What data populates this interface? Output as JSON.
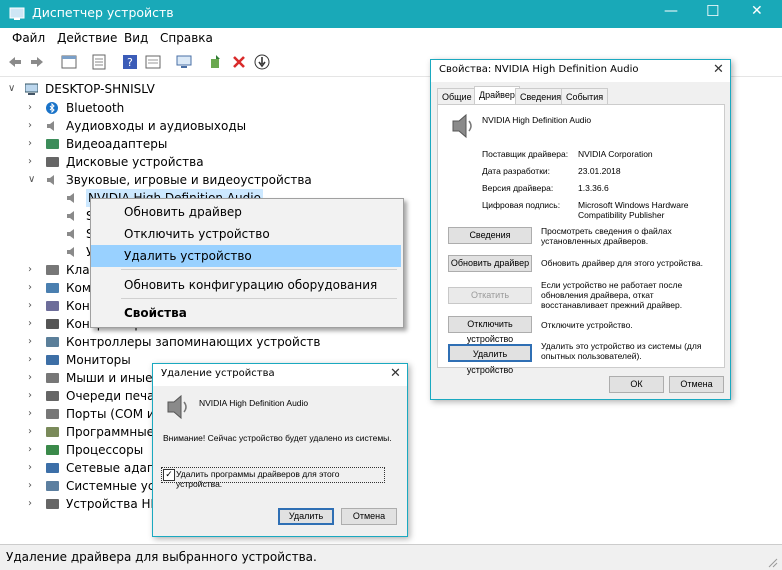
{
  "window": {
    "title": "Диспетчер устройств",
    "minimize": "—",
    "maximize": "☐",
    "close": "✕"
  },
  "menu": [
    "Файл",
    "Действие",
    "Вид",
    "Справка"
  ],
  "tree": {
    "root": "DESKTOP-SHNISLV",
    "items": [
      {
        "label": "Bluetooth",
        "icon": "bluetooth-icon"
      },
      {
        "label": "Аудиовходы и аудиовыходы",
        "icon": "speaker-icon"
      },
      {
        "label": "Видеоадаптеры",
        "icon": "display-adapter-icon"
      },
      {
        "label": "Дисковые устройства",
        "icon": "disk-drive-icon"
      },
      {
        "label": "Звуковые, игровые и видеоустройства",
        "icon": "speaker-icon"
      },
      {
        "label": "NVIDIA High Definition Audio",
        "icon": "speaker-icon"
      },
      {
        "label": "S",
        "icon": "speaker-icon"
      },
      {
        "label": "S",
        "icon": "speaker-icon"
      },
      {
        "label": "У",
        "icon": "speaker-icon"
      },
      {
        "label": "Клав",
        "icon": "keyboard-icon"
      },
      {
        "label": "Комп",
        "icon": "computer-icon"
      },
      {
        "label": "Конт",
        "icon": "controller-icon"
      },
      {
        "label": "Контроллеры USB",
        "icon": "usb-icon"
      },
      {
        "label": "Контроллеры запоминающих устройств",
        "icon": "storage-icon"
      },
      {
        "label": "Мониторы",
        "icon": "monitor-icon"
      },
      {
        "label": "Мыши и иные у",
        "icon": "mouse-icon"
      },
      {
        "label": "Очереди печати",
        "icon": "printer-icon"
      },
      {
        "label": "Порты (COM и L",
        "icon": "port-icon"
      },
      {
        "label": "Программные",
        "icon": "software-icon"
      },
      {
        "label": "Процессоры",
        "icon": "cpu-icon"
      },
      {
        "label": "Сетевые адапте",
        "icon": "network-icon"
      },
      {
        "label": "Системные устр",
        "icon": "system-icon"
      },
      {
        "label": "Устройства HID",
        "icon": "hid-icon"
      }
    ]
  },
  "context_menu": {
    "items": [
      "Обновить драйвер",
      "Отключить устройство",
      "Удалить устройство",
      "Обновить конфигурацию оборудования",
      "Свойства"
    ],
    "highlighted_index": 2
  },
  "properties": {
    "title": "Свойства: NVIDIA High Definition Audio",
    "tabs": [
      "Общие",
      "Драйвер",
      "Сведения",
      "События"
    ],
    "active_tab": "Драйвер",
    "device_name": "NVIDIA High Definition Audio",
    "fields": [
      {
        "label": "Поставщик драйвера:",
        "value": "NVIDIA Corporation"
      },
      {
        "label": "Дата разработки:",
        "value": "23.01.2018"
      },
      {
        "label": "Версия драйвера:",
        "value": "1.3.36.6"
      },
      {
        "label": "Цифровая подпись:",
        "value": "Microsoft Windows Hardware Compatibility Publisher"
      }
    ],
    "buttons": [
      {
        "label": "Сведения",
        "desc": "Просмотреть сведения о файлах установленных драйверов."
      },
      {
        "label": "Обновить драйвер",
        "desc": "Обновить драйвер для этого устройства."
      },
      {
        "label": "Откатить",
        "desc": "Если устройство не работает после обновления драйвера, откат восстанавливает прежний драйвер."
      },
      {
        "label": "Отключить устройство",
        "desc": "Отключите устройство."
      },
      {
        "label": "Удалить устройство",
        "desc": "Удалить это устройство из системы (для опытных пользователей)."
      }
    ],
    "ok": "ОК",
    "cancel": "Отмена"
  },
  "remove_dialog": {
    "title": "Удаление устройства",
    "device_name": "NVIDIA High Definition Audio",
    "warning": "Внимание! Сейчас устройство будет удалено из системы.",
    "checkbox_label": "Удалить программы драйверов для этого устройства.",
    "checkbox_checked": true,
    "remove": "Удалить",
    "cancel": "Отмена"
  },
  "statusbar": "Удаление драйвера для выбранного устройства.",
  "colors": {
    "title_bar": "#19a9b8",
    "highlight": "#99d1ff",
    "dialog_border": "#1aa9c0"
  }
}
